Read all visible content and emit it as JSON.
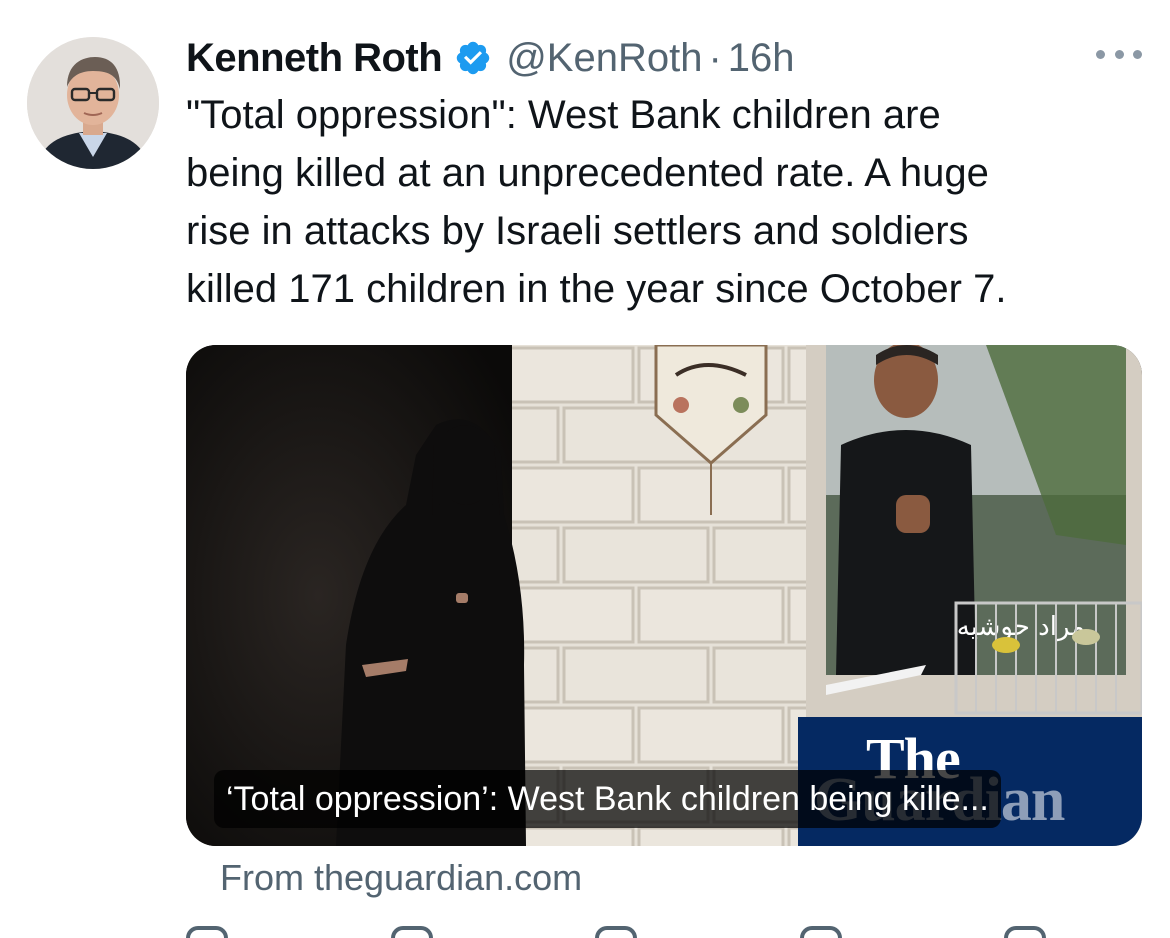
{
  "author": {
    "name": "Kenneth Roth",
    "handle": "@KenRoth",
    "separator": "·",
    "time": "16h",
    "verified": true
  },
  "tweet": {
    "lines": [
      "\"Total oppression\": West Bank children are",
      "being killed at an unprecedented rate. A huge",
      "rise in attacks by Israeli settlers and soldiers",
      "killed 171 children in the year since October 7."
    ]
  },
  "link_card": {
    "title": "‘Total oppression’: West Bank children being kille...",
    "source": "From theguardian.com",
    "logo_line1": "The",
    "logo_line2": "Guardian"
  },
  "icons": {
    "verified": "verified-badge-icon",
    "more": "more-options-icon"
  },
  "colors": {
    "verified_blue": "#1d9bf0",
    "secondary_text": "#536471",
    "guardian_blue": "#052962"
  }
}
